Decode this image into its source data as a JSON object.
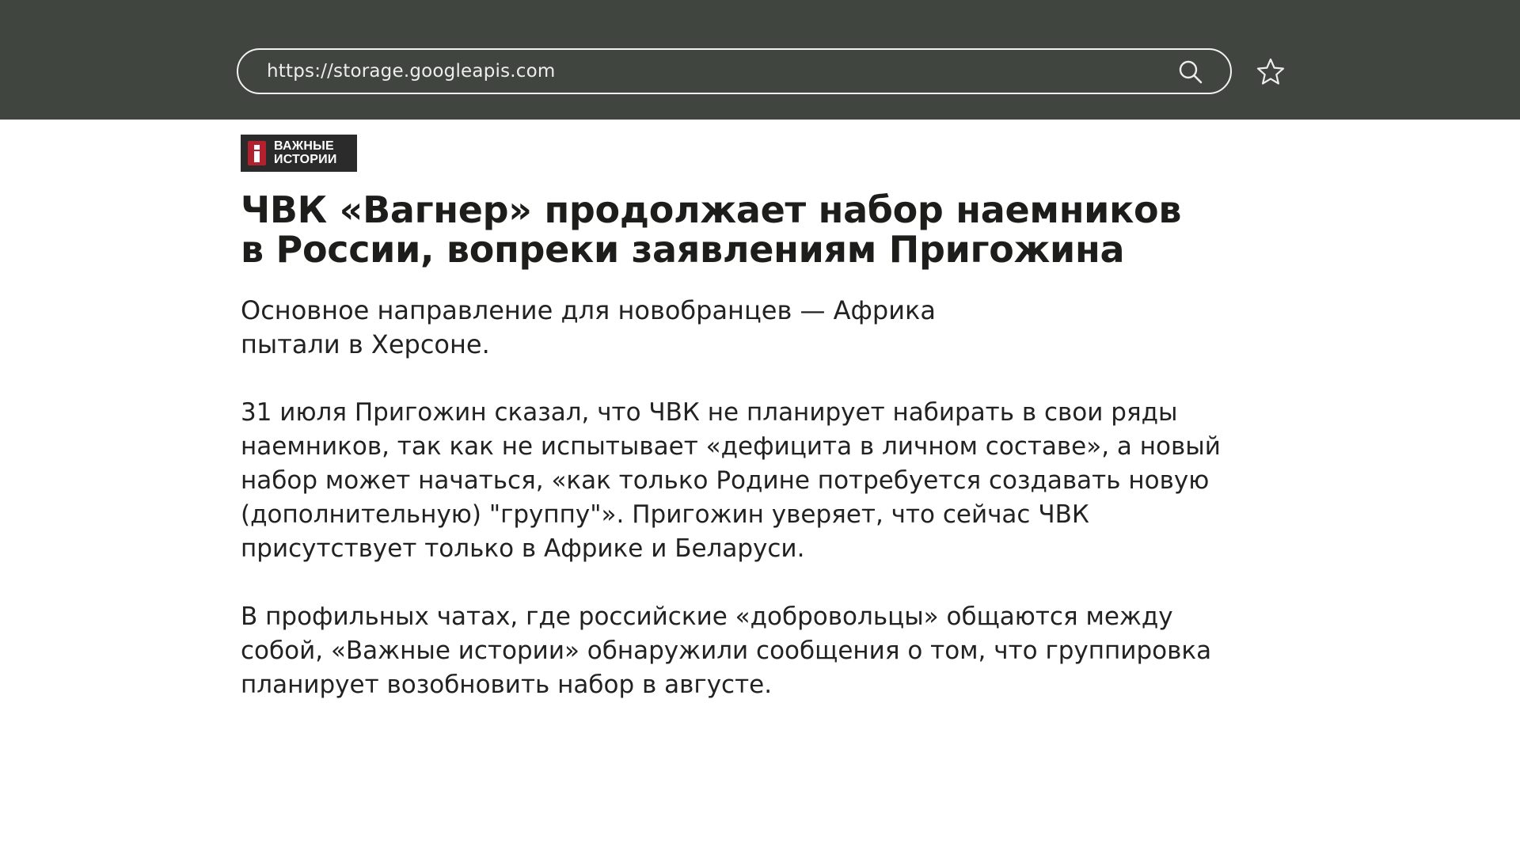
{
  "browser": {
    "url": "https://storage.googleapis.com",
    "search_icon": "search-icon",
    "bookmark_icon": "star-icon"
  },
  "brand": {
    "line1": "ВАЖНЫЕ",
    "line2": "ИСТОРИИ",
    "accent_color": "#b3212e"
  },
  "article": {
    "title_lines": [
      "ЧВК «Вагнер» продолжает набор наемников",
      "в России, вопреки заявлениям Пригожина"
    ],
    "lead_lines": [
      "Основное направление для новобранцев — Африка",
      "пытали в Херсоне."
    ],
    "paragraph1_lines": [
      "31 июля Пригожин сказал, что ЧВК не планирует набирать в свои ряды",
      "наемников, так как не испытывает «дефицита в личном составе», а новый",
      "набор может начаться, «как только Родине потребуется создавать новую",
      "(дополнительную) \"группу\"». Пригожин уверяет, что сейчас ЧВК",
      "присутствует только в Африке и Беларуси."
    ],
    "paragraph2_lines": [
      "В профильных чатах, где российские «добровольцы» общаются между",
      "собой, «Важные истории» обнаружили сообщения о том, что группировка",
      "планирует возобновить набор в августе."
    ]
  },
  "colors": {
    "topbar": "#41453f",
    "text": "#1d1d1b"
  }
}
